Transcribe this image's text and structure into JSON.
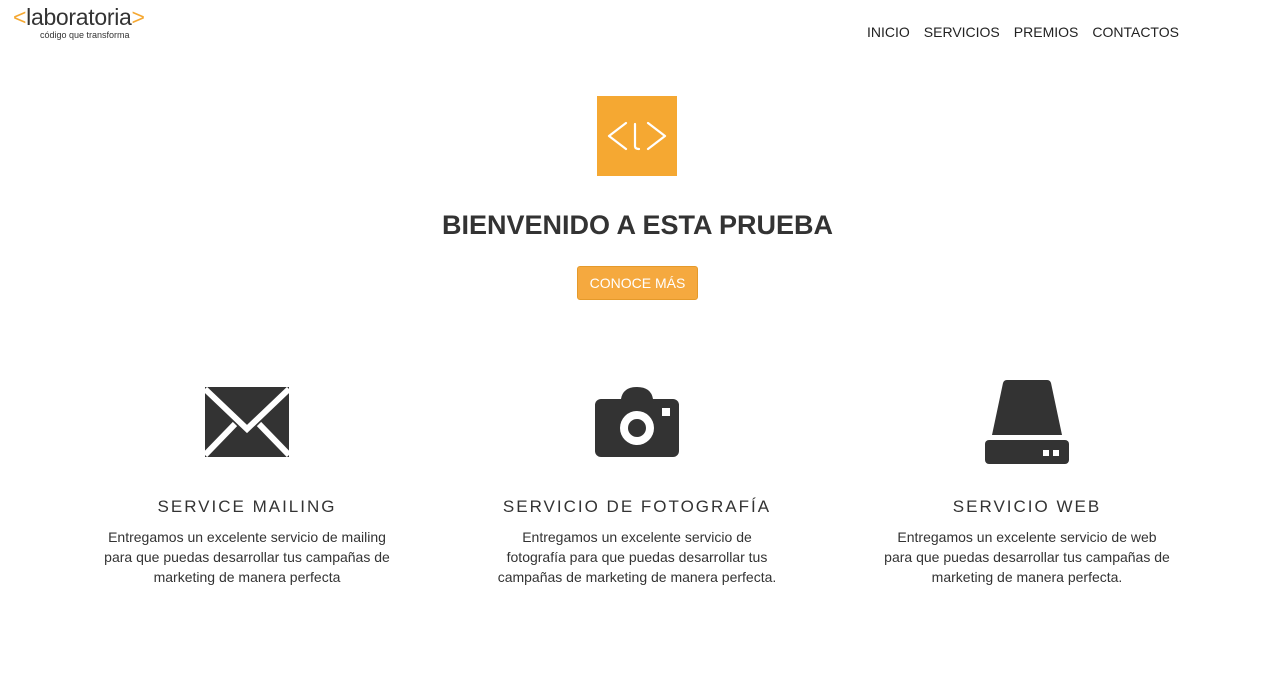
{
  "header": {
    "logo": {
      "bracket_open": "<",
      "word": "laboratoria",
      "bracket_close": ">",
      "tagline": "código que transforma"
    },
    "nav": [
      {
        "label": "INICIO"
      },
      {
        "label": "SERVICIOS"
      },
      {
        "label": "PREMIOS"
      },
      {
        "label": "CONTACTOS"
      }
    ]
  },
  "hero": {
    "logo_glyph": "<l>",
    "title": "BIENVENIDO A ESTA PRUEBA",
    "button_label": "CONOCE MÁS"
  },
  "services": [
    {
      "icon": "envelope-icon",
      "title": "SERVICE MAILING",
      "description": "Entregamos un excelente servicio de mailing para que puedas desarrollar tus campañas de marketing de manera perfecta"
    },
    {
      "icon": "camera-icon",
      "title": "SERVICIO DE FOTOGRAFÍA",
      "description": "Entregamos un excelente servicio de fotografía para que puedas desarrollar tus campañas de marketing de manera perfecta."
    },
    {
      "icon": "hard-drive-icon",
      "title": "SERVICIO WEB",
      "description": "Entregamos un excelente servicio de web para que puedas desarrollar tus campañas de marketing de manera perfecta."
    }
  ],
  "colors": {
    "accent": "#f5a832",
    "text": "#333333",
    "background": "#ffffff"
  }
}
